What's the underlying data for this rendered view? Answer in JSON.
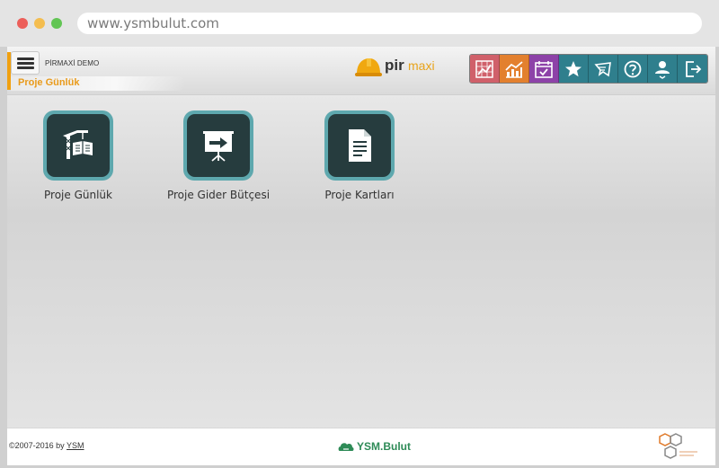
{
  "browser": {
    "url": "www.ysmbulut.com"
  },
  "header": {
    "company": "PİRMAXİ DEMO",
    "breadcrumb": "Proje Günlük",
    "logo": {
      "pir": "pir",
      "maxi": "maxi"
    }
  },
  "toolbar": [
    {
      "icon": "chart-grid-icon",
      "color": "#c85a62"
    },
    {
      "icon": "trend-chart-icon",
      "color": "#e07a2a"
    },
    {
      "icon": "calendar-check-icon",
      "color": "#8b3fa6"
    },
    {
      "icon": "star-icon",
      "color": "#2f7e8c"
    },
    {
      "icon": "message-icon",
      "color": "#2f7e8c"
    },
    {
      "icon": "help-icon",
      "color": "#2f7e8c"
    },
    {
      "icon": "user-icon",
      "color": "#2f7e8c"
    },
    {
      "icon": "logout-icon",
      "color": "#2f7e8c"
    }
  ],
  "tiles": [
    {
      "label": "Proje Günlük",
      "icon": "crane-book-icon"
    },
    {
      "label": "Proje Gider Bütçesi",
      "icon": "presentation-arrow-icon"
    },
    {
      "label": "Proje Kartları",
      "icon": "document-icon"
    }
  ],
  "footer": {
    "copyright_prefix": "©2007-2016 by ",
    "copyright_link": "YSM",
    "brand": "YSM.Bulut"
  },
  "colors": {
    "accent_orange": "#e99a1a",
    "tile_border": "#5ea8ae",
    "tile_bg": "#263c3e"
  }
}
